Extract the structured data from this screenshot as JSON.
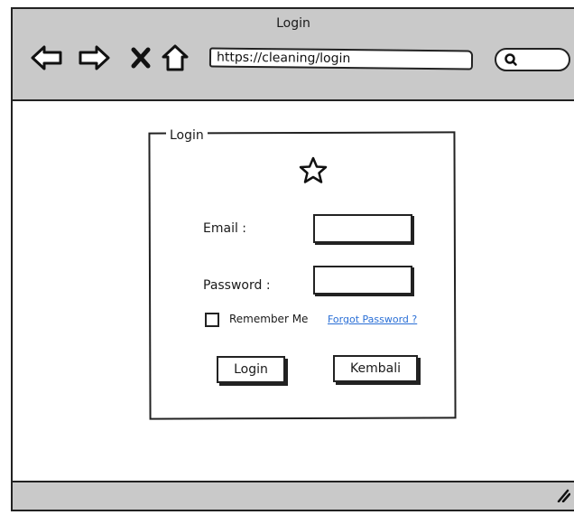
{
  "window": {
    "title": "Login",
    "url": "https://cleaning/login"
  },
  "toolbar": {
    "back_icon": "back-arrow-icon",
    "forward_icon": "forward-arrow-icon",
    "stop_icon": "close-icon",
    "home_icon": "home-icon",
    "search_icon": "search-icon"
  },
  "login_form": {
    "legend": "Login",
    "logo_icon": "star-icon",
    "email_label": "Email :",
    "email_value": "",
    "password_label": "Password :",
    "password_value": "",
    "remember_label": "Remember Me",
    "remember_checked": false,
    "forgot_link": "Forgot Password ?",
    "login_button": "Login",
    "back_button": "Kembali"
  },
  "colors": {
    "chrome": "#c9c9c9",
    "link": "#2a6fd6",
    "ink": "#222222"
  }
}
